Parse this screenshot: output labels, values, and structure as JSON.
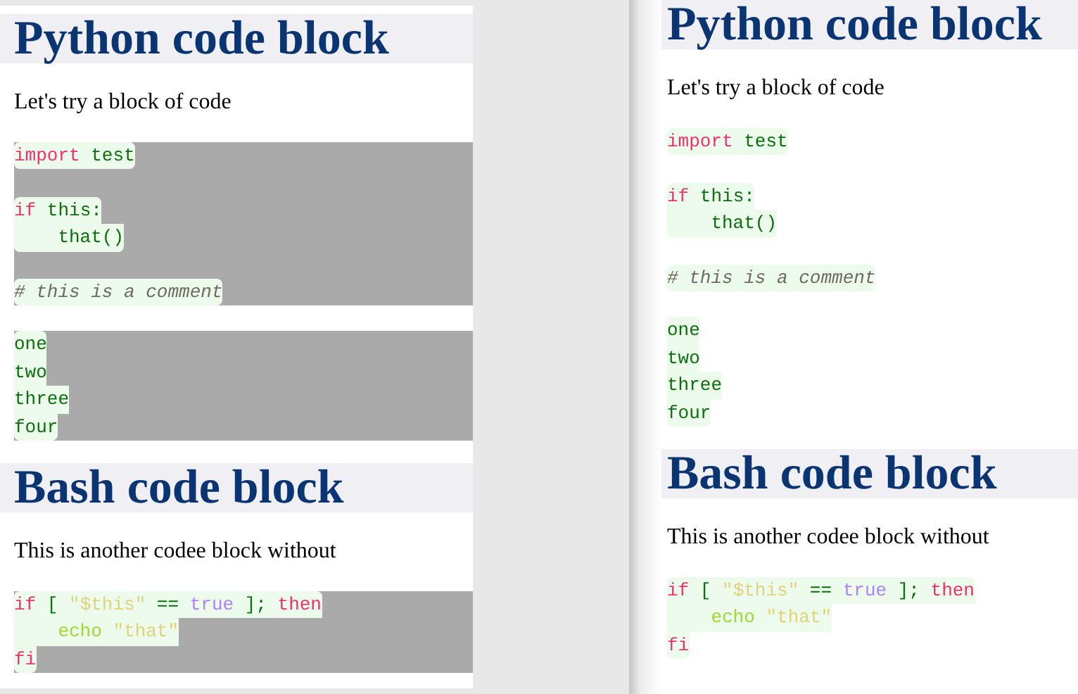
{
  "panels": [
    {
      "shaded": true,
      "sections": [
        {
          "heading": "Python code block",
          "text": "Let's try a block of code",
          "blocks": [
            {
              "groups": [
                [
                  [
                    {
                      "kind": "kw",
                      "t": "import"
                    },
                    {
                      "kind": "name",
                      "t": " test"
                    }
                  ]
                ],
                [
                  [
                    {
                      "kind": "kw",
                      "t": "if"
                    },
                    {
                      "kind": "name",
                      "t": " this:"
                    }
                  ],
                  [
                    {
                      "kind": "name",
                      "t": "    that()"
                    }
                  ]
                ],
                [
                  [
                    {
                      "kind": "comment",
                      "t": "# this is a comment"
                    }
                  ]
                ]
              ]
            },
            {
              "groups": [
                [
                  [
                    {
                      "kind": "name",
                      "t": "one"
                    }
                  ],
                  [
                    {
                      "kind": "name",
                      "t": "two"
                    }
                  ],
                  [
                    {
                      "kind": "name",
                      "t": "three"
                    }
                  ],
                  [
                    {
                      "kind": "name",
                      "t": "four"
                    }
                  ]
                ]
              ]
            }
          ]
        },
        {
          "heading": "Bash code block",
          "text": "This is another codee block without",
          "blocks": [
            {
              "groups": [
                [
                  [
                    {
                      "kind": "kw",
                      "t": "if"
                    },
                    {
                      "kind": "name",
                      "t": " [ "
                    },
                    {
                      "kind": "str",
                      "t": "\"$this\""
                    },
                    {
                      "kind": "name",
                      "t": " == "
                    },
                    {
                      "kind": "const",
                      "t": "true"
                    },
                    {
                      "kind": "name",
                      "t": " ]; "
                    },
                    {
                      "kind": "kw",
                      "t": "then"
                    }
                  ],
                  [
                    {
                      "kind": "builtin",
                      "t": "    echo"
                    },
                    {
                      "kind": "str",
                      "t": " \"that\""
                    }
                  ],
                  [
                    {
                      "kind": "kw",
                      "t": "fi"
                    }
                  ]
                ]
              ]
            }
          ]
        }
      ]
    },
    {
      "shaded": false,
      "sections": [
        {
          "heading": "Python code block",
          "text": "Let's try a block of code",
          "blocks": [
            {
              "groups": [
                [
                  [
                    {
                      "kind": "kw",
                      "t": "import"
                    },
                    {
                      "kind": "name",
                      "t": " test"
                    }
                  ]
                ],
                [
                  [
                    {
                      "kind": "kw",
                      "t": "if"
                    },
                    {
                      "kind": "name",
                      "t": " this:"
                    }
                  ],
                  [
                    {
                      "kind": "name",
                      "t": "    that()"
                    }
                  ]
                ],
                [
                  [
                    {
                      "kind": "comment",
                      "t": "# this is a comment"
                    }
                  ]
                ]
              ]
            },
            {
              "groups": [
                [
                  [
                    {
                      "kind": "name",
                      "t": "one"
                    }
                  ],
                  [
                    {
                      "kind": "name",
                      "t": "two"
                    }
                  ],
                  [
                    {
                      "kind": "name",
                      "t": "three"
                    }
                  ],
                  [
                    {
                      "kind": "name",
                      "t": "four"
                    }
                  ]
                ]
              ]
            }
          ]
        },
        {
          "heading": "Bash code block",
          "text": "This is another codee block without",
          "blocks": [
            {
              "groups": [
                [
                  [
                    {
                      "kind": "kw",
                      "t": "if"
                    },
                    {
                      "kind": "name",
                      "t": " [ "
                    },
                    {
                      "kind": "str",
                      "t": "\"$this\""
                    },
                    {
                      "kind": "name",
                      "t": " == "
                    },
                    {
                      "kind": "const",
                      "t": "true"
                    },
                    {
                      "kind": "name",
                      "t": " ]; "
                    },
                    {
                      "kind": "kw",
                      "t": "then"
                    }
                  ],
                  [
                    {
                      "kind": "builtin",
                      "t": "    echo"
                    },
                    {
                      "kind": "str",
                      "t": " \"that\""
                    }
                  ],
                  [
                    {
                      "kind": "kw",
                      "t": "fi"
                    }
                  ]
                ]
              ]
            }
          ]
        }
      ]
    }
  ]
}
